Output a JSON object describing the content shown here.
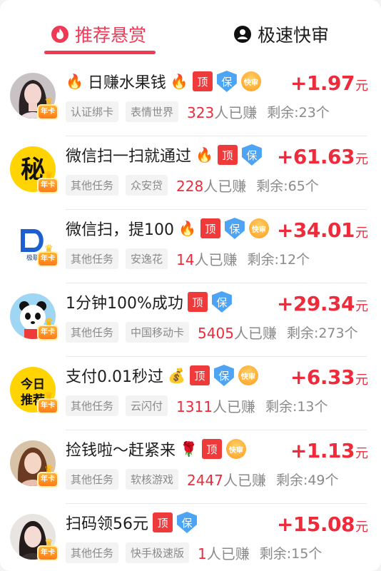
{
  "tabs": {
    "recommended": {
      "label": "推荐悬赏",
      "icon": "flame-icon"
    },
    "fast_review": {
      "label": "极速快审",
      "icon": "user-circle-icon"
    }
  },
  "colors": {
    "accent": "#ee3a57",
    "reward": "#ee2b3b",
    "bao": "#4da3f4",
    "top": "#ee3a3a"
  },
  "badges": {
    "top": "顶",
    "bao": "保",
    "fast": "快审",
    "vip": "年卡"
  },
  "tasks": [
    {
      "title": "日赚水果钱",
      "pre_emoji": "🔥",
      "post_emoji": "🔥",
      "badges": [
        "top",
        "bao",
        "fast"
      ],
      "category": "认证绑卡",
      "sponsor": "表情世界",
      "earned_count": "323",
      "earned_suffix": "人已赚",
      "remaining": "剩余:23个",
      "amount": "+1.97",
      "unit": "元",
      "avatar": "girl-portrait"
    },
    {
      "title": "微信扫一扫就通过",
      "pre_emoji": "",
      "post_emoji": "🔥",
      "badges": [
        "top",
        "bao"
      ],
      "category": "其他任务",
      "sponsor": "众安贷",
      "earned_count": "228",
      "earned_suffix": "人已赚",
      "remaining": "剩余:65个",
      "amount": "+61.63",
      "unit": "元",
      "avatar": "miao-text-logo"
    },
    {
      "title": "微信扫，提100",
      "pre_emoji": "",
      "post_emoji": "🔥",
      "badges": [
        "top",
        "bao",
        "fast"
      ],
      "category": "其他任务",
      "sponsor": "安逸花",
      "earned_count": "14",
      "earned_suffix": "人已赚",
      "remaining": "剩余:12个",
      "amount": "+34.01",
      "unit": "元",
      "avatar": "d-logo"
    },
    {
      "title": "1分钟100%成功",
      "pre_emoji": "",
      "post_emoji": "",
      "badges": [
        "top",
        "bao"
      ],
      "category": "其他任务",
      "sponsor": "中国移动卡",
      "earned_count": "5405",
      "earned_suffix": "人已赚",
      "remaining": "剩余:273个",
      "amount": "+29.34",
      "unit": "元",
      "avatar": "panda"
    },
    {
      "title": "支付0.01秒过",
      "pre_emoji": "",
      "post_emoji": "💰",
      "badges": [
        "top",
        "bao",
        "fast"
      ],
      "category": "其他任务",
      "sponsor": "云闪付",
      "earned_count": "1311",
      "earned_suffix": "人已赚",
      "remaining": "剩余:13个",
      "amount": "+6.33",
      "unit": "元",
      "avatar": "today-recommend"
    },
    {
      "title": "捡钱啦～赶紧来",
      "pre_emoji": "",
      "post_emoji": "🌹",
      "badges": [
        "top",
        "fast"
      ],
      "category": "其他任务",
      "sponsor": "软核游戏",
      "earned_count": "2447",
      "earned_suffix": "人已赚",
      "remaining": "剩余:49个",
      "amount": "+1.13",
      "unit": "元",
      "avatar": "girl-portrait-2"
    },
    {
      "title": "扫码领56元",
      "pre_emoji": "",
      "post_emoji": "",
      "badges": [
        "top",
        "bao"
      ],
      "category": "其他任务",
      "sponsor": "快手极速版",
      "earned_count": "1",
      "earned_suffix": "人已赚",
      "remaining": "剩余:15个",
      "amount": "+15.08",
      "unit": "元",
      "avatar": "girl-portrait-3"
    }
  ]
}
